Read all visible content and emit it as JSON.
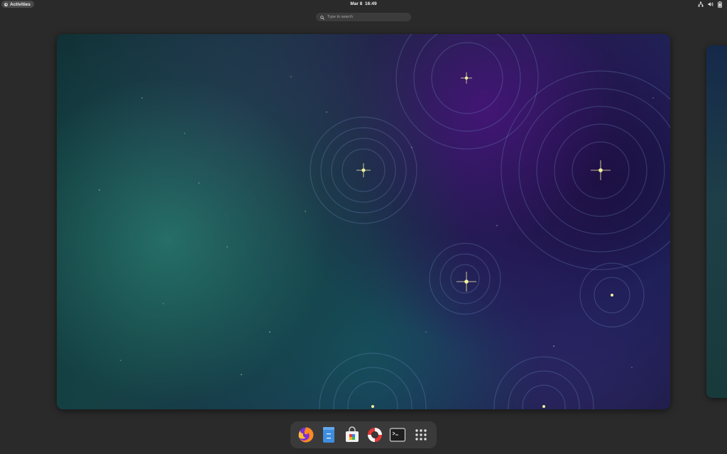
{
  "topbar": {
    "activities_label": "Activities",
    "date": "Mar 8",
    "time": "16:49",
    "tray_icons": [
      "network-icon",
      "volume-icon",
      "battery-icon"
    ]
  },
  "search": {
    "placeholder": "Type to search"
  },
  "dash": {
    "apps": [
      {
        "name": "Firefox",
        "icon": "firefox-icon"
      },
      {
        "name": "Files",
        "icon": "files-icon"
      },
      {
        "name": "Software",
        "icon": "software-icon"
      },
      {
        "name": "Help",
        "icon": "help-icon"
      },
      {
        "name": "Terminal",
        "icon": "terminal-icon"
      },
      {
        "name": "Show Applications",
        "icon": "app-grid-icon"
      }
    ]
  },
  "colors": {
    "panel": "#2a2a2a",
    "dash": "#3a3a3a",
    "search_bg": "#3c3c3c",
    "wallpaper_teal": "#1f6b64",
    "wallpaper_purple": "#4b2180"
  }
}
